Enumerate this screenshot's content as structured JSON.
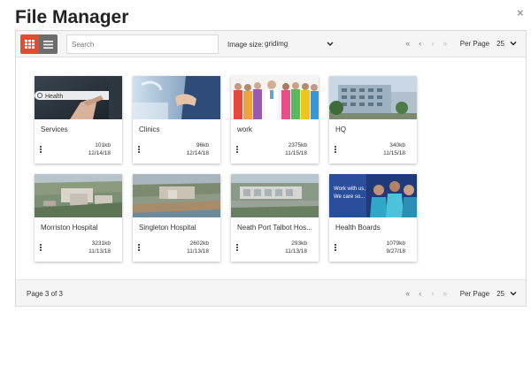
{
  "header": {
    "title": "File Manager",
    "close_glyph": "×"
  },
  "toolbar": {
    "view_grid_icon": "grid-view-icon",
    "view_list_icon": "list-view-icon",
    "search_placeholder": "Search",
    "image_size_label": "Image size:",
    "image_size_value": "gridimg"
  },
  "pagination": {
    "first": "«",
    "prev": "‹",
    "next": "›",
    "last": "»",
    "per_page_label": "Per Page",
    "per_page_value": "25",
    "status": "Page 3 of 3"
  },
  "files": [
    {
      "name": "Services",
      "size": "101kb",
      "date": "12/14/18",
      "thumb": "health-search"
    },
    {
      "name": "Clinics",
      "size": "96kb",
      "date": "12/14/18",
      "thumb": "clinic-doctor"
    },
    {
      "name": "work",
      "size": "2375kb",
      "date": "11/15/18",
      "thumb": "staff-group"
    },
    {
      "name": "HQ",
      "size": "340kb",
      "date": "11/15/18",
      "thumb": "hq-building"
    },
    {
      "name": "Morriston Hospital",
      "size": "3231kb",
      "date": "11/13/18",
      "thumb": "aerial-hospital"
    },
    {
      "name": "Singleton Hospital",
      "size": "2602kb",
      "date": "11/13/18",
      "thumb": "aerial-coast"
    },
    {
      "name": "Neath Port Talbot Hos...",
      "size": "293kb",
      "date": "11/13/18",
      "thumb": "aerial-campus"
    },
    {
      "name": "Health Boards",
      "size": "1079kb",
      "date": "9/27/18",
      "thumb": "health-board-staff"
    }
  ],
  "thumb_text": {
    "health": "Health",
    "banner1": "Work with us,",
    "banner2": "We care so..."
  },
  "colors": {
    "accent": "#e44c31",
    "list_button": "#6d6d6d"
  }
}
